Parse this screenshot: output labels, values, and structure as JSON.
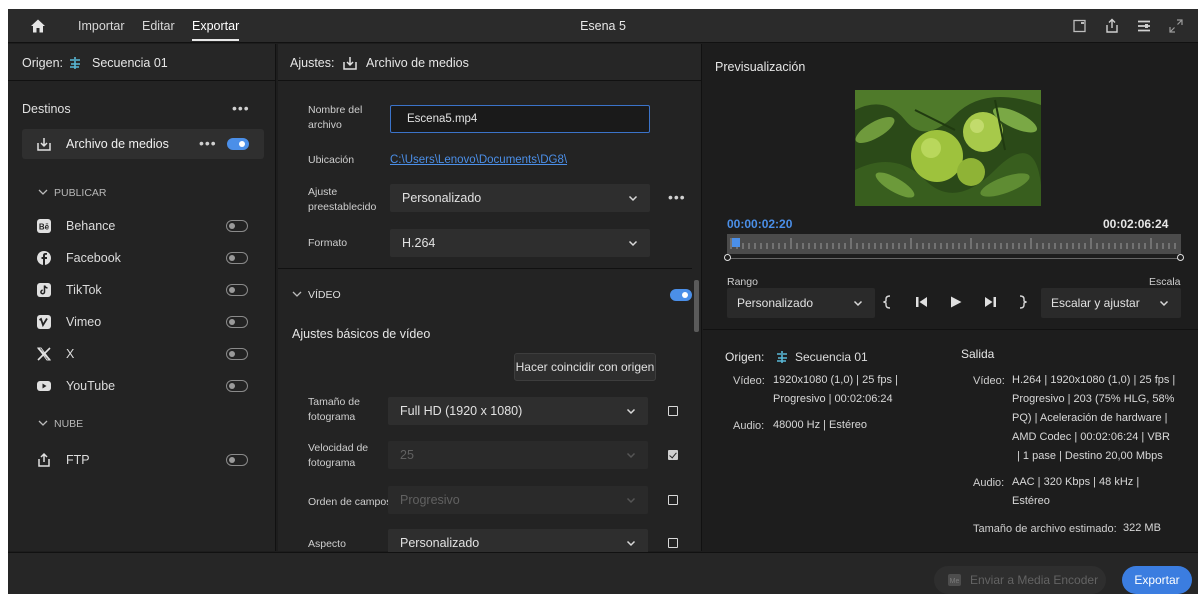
{
  "nav": {
    "import": "Importar",
    "edit": "Editar",
    "export": "Exportar"
  },
  "window_title": "Esena 5",
  "left": {
    "origin_label": "Origen:",
    "origin_value": "Secuencia 01",
    "destinations_label": "Destinos",
    "media_file": "Archivo de medios",
    "publish_section": "PUBLICAR",
    "cloud_section": "NUBE",
    "services": [
      "Behance",
      "Facebook",
      "TikTok",
      "Vimeo",
      "X",
      "YouTube"
    ],
    "ftp": "FTP"
  },
  "mid": {
    "settings_label": "Ajustes:",
    "settings_value": "Archivo de medios",
    "filename_label": "Nombre del archivo",
    "filename_value": "Escena5.mp4",
    "location_label": "Ubicación",
    "location_value": "C:\\Users\\Lenovo\\Documents\\DG8\\",
    "preset_label": "Ajuste preestablecido",
    "preset_value": "Personalizado",
    "format_label": "Formato",
    "format_value": "H.264",
    "video_section": "VÍDEO",
    "basic_video": "Ajustes básicos de vídeo",
    "match_source": "Hacer coincidir con origen",
    "frame_size_label": "Tamaño de fotograma",
    "frame_size_value": "Full HD (1920 x 1080)",
    "frame_rate_label": "Velocidad de fotograma",
    "frame_rate_value": "25",
    "field_order_label": "Orden de campos",
    "field_order_value": "Progresivo",
    "aspect_label": "Aspecto",
    "aspect_value": "Personalizado"
  },
  "right": {
    "preview_label": "Previsualización",
    "tc_in": "00:00:02:20",
    "tc_out": "00:02:06:24",
    "range_label": "Rango",
    "range_value": "Personalizado",
    "scale_label": "Escala",
    "scale_value": "Escalar y ajustar",
    "source_label": "Origen:",
    "source_value": "Secuencia 01",
    "src_video_label": "Vídeo:",
    "src_video_line1": "1920x1080 (1,0) | 25 fps |",
    "src_video_line2": "Progresivo | 00:02:06:24",
    "src_audio_label": "Audio:",
    "src_audio_value": "48000 Hz | Estéreo",
    "output_label": "Salida",
    "out_video_label": "Vídeo:",
    "out_video_lines": [
      "H.264 | 1920x1080 (1,0) | 25 fps |",
      "Progresivo | 203 (75% HLG, 58%",
      "PQ) | Aceleración de hardware |",
      "AMD Codec | 00:02:06:24 | VBR",
      "| 1 pase | Destino 20,00 Mbps"
    ],
    "out_audio_label": "Audio:",
    "out_audio_lines": [
      "AAC | 320 Kbps | 48 kHz |",
      "Estéreo"
    ],
    "size_label": "Tamaño de archivo estimado:",
    "size_value": "322 MB"
  },
  "bottom": {
    "media_encoder": "Enviar a Media Encoder",
    "export": "Exportar"
  },
  "colors": {
    "accent": "#4b8fe8",
    "bg": "#1d1d1d",
    "panel": "#232323"
  }
}
